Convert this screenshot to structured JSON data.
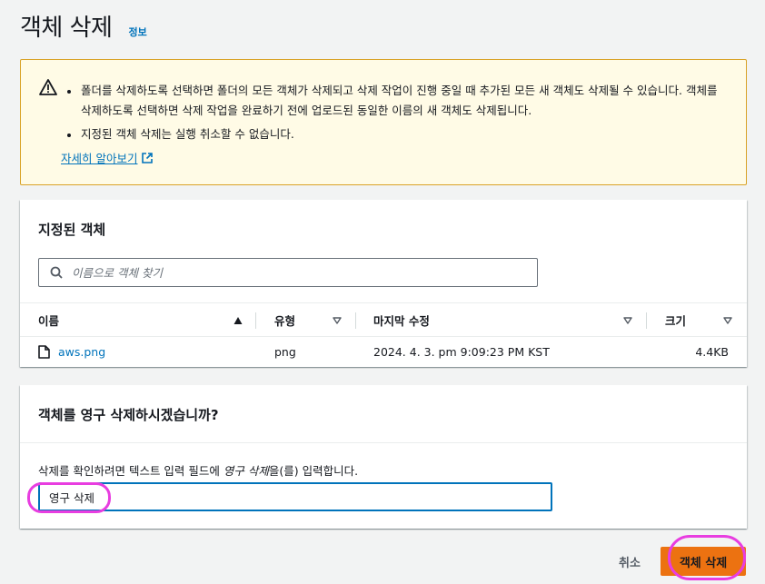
{
  "header": {
    "title": "객체 삭제",
    "info": "정보"
  },
  "warning": {
    "icon": "warning-icon",
    "items": [
      "폴더를 삭제하도록 선택하면 폴더의 모든 객체가 삭제되고 삭제 작업이 진행 중일 때 추가된 모든 새 객체도 삭제될 수 있습니다. 객체를 삭제하도록 선택하면 삭제 작업을 완료하기 전에 업로드된 동일한 이름의 새 객체도 삭제됩니다.",
      "지정된 객체 삭제는 실행 취소할 수 없습니다."
    ],
    "learn_more": "자세히 알아보기"
  },
  "objects": {
    "heading": "지정된 객체",
    "search_placeholder": "이름으로 객체 찾기",
    "columns": [
      "이름",
      "유형",
      "마지막 수정",
      "크기"
    ],
    "rows": [
      {
        "name": "aws.png",
        "type": "png",
        "modified": "2024. 4. 3. pm 9:09:23 PM KST",
        "size": "4.4KB"
      }
    ]
  },
  "confirm": {
    "heading": "객체를 영구 삭제하시겠습니까?",
    "label_prefix": "삭제를 확인하려면 텍스트 입력 필드에 ",
    "label_keyword": "영구 삭제",
    "label_suffix": "을(를) 입력합니다.",
    "input_value": "영구 삭제"
  },
  "actions": {
    "cancel": "취소",
    "delete": "객체 삭제"
  },
  "colors": {
    "primary": "#ec7211",
    "link": "#0073bb",
    "warning_bg": "#fffbe6",
    "annotation": "#e83de0"
  }
}
